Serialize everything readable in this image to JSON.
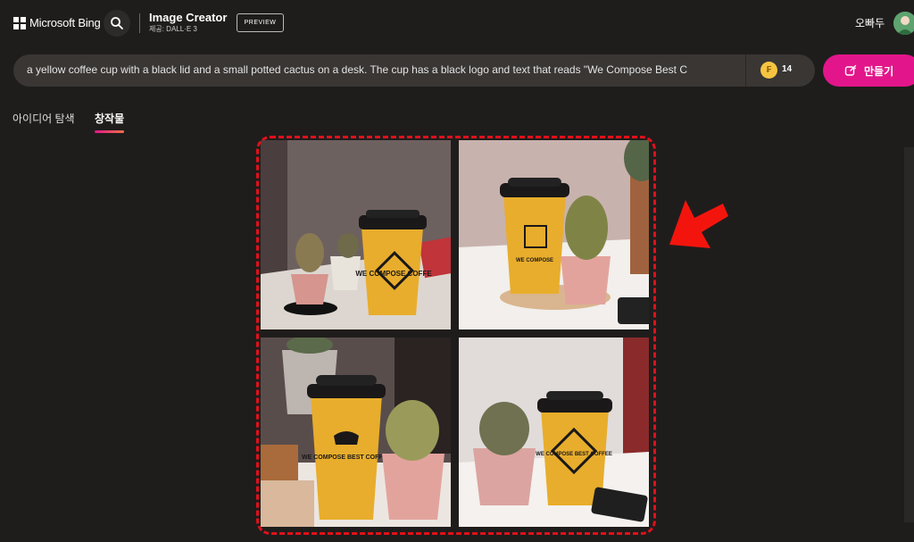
{
  "header": {
    "brand": "Microsoft Bing",
    "app_title": "Image Creator",
    "app_subtitle": "제공: DALL·E 3",
    "preview_badge": "PREVIEW",
    "user_name": "오빠두"
  },
  "prompt": {
    "value": "a yellow coffee cup with a black lid and a small potted cactus on a desk. The cup has a black logo and text that reads \"We Compose Best C",
    "coins": "14",
    "create_label": "만들기"
  },
  "tabs": [
    {
      "label": "아이디어 탐색",
      "active": false
    },
    {
      "label": "창작물",
      "active": true
    }
  ],
  "images": [
    {
      "cup_text": "WE COMPOSE COFFE"
    },
    {
      "cup_text": "WE COMPOSE"
    },
    {
      "cup_text": "WE COMPOSE BEST COFFEE"
    },
    {
      "cup_text": "WE COMPOSE BEST COFFEE"
    }
  ],
  "colors": {
    "background": "#1f1d1c",
    "accent": "#e2168a",
    "highlight": "#e0101a",
    "cup": "#e8ad2c"
  }
}
